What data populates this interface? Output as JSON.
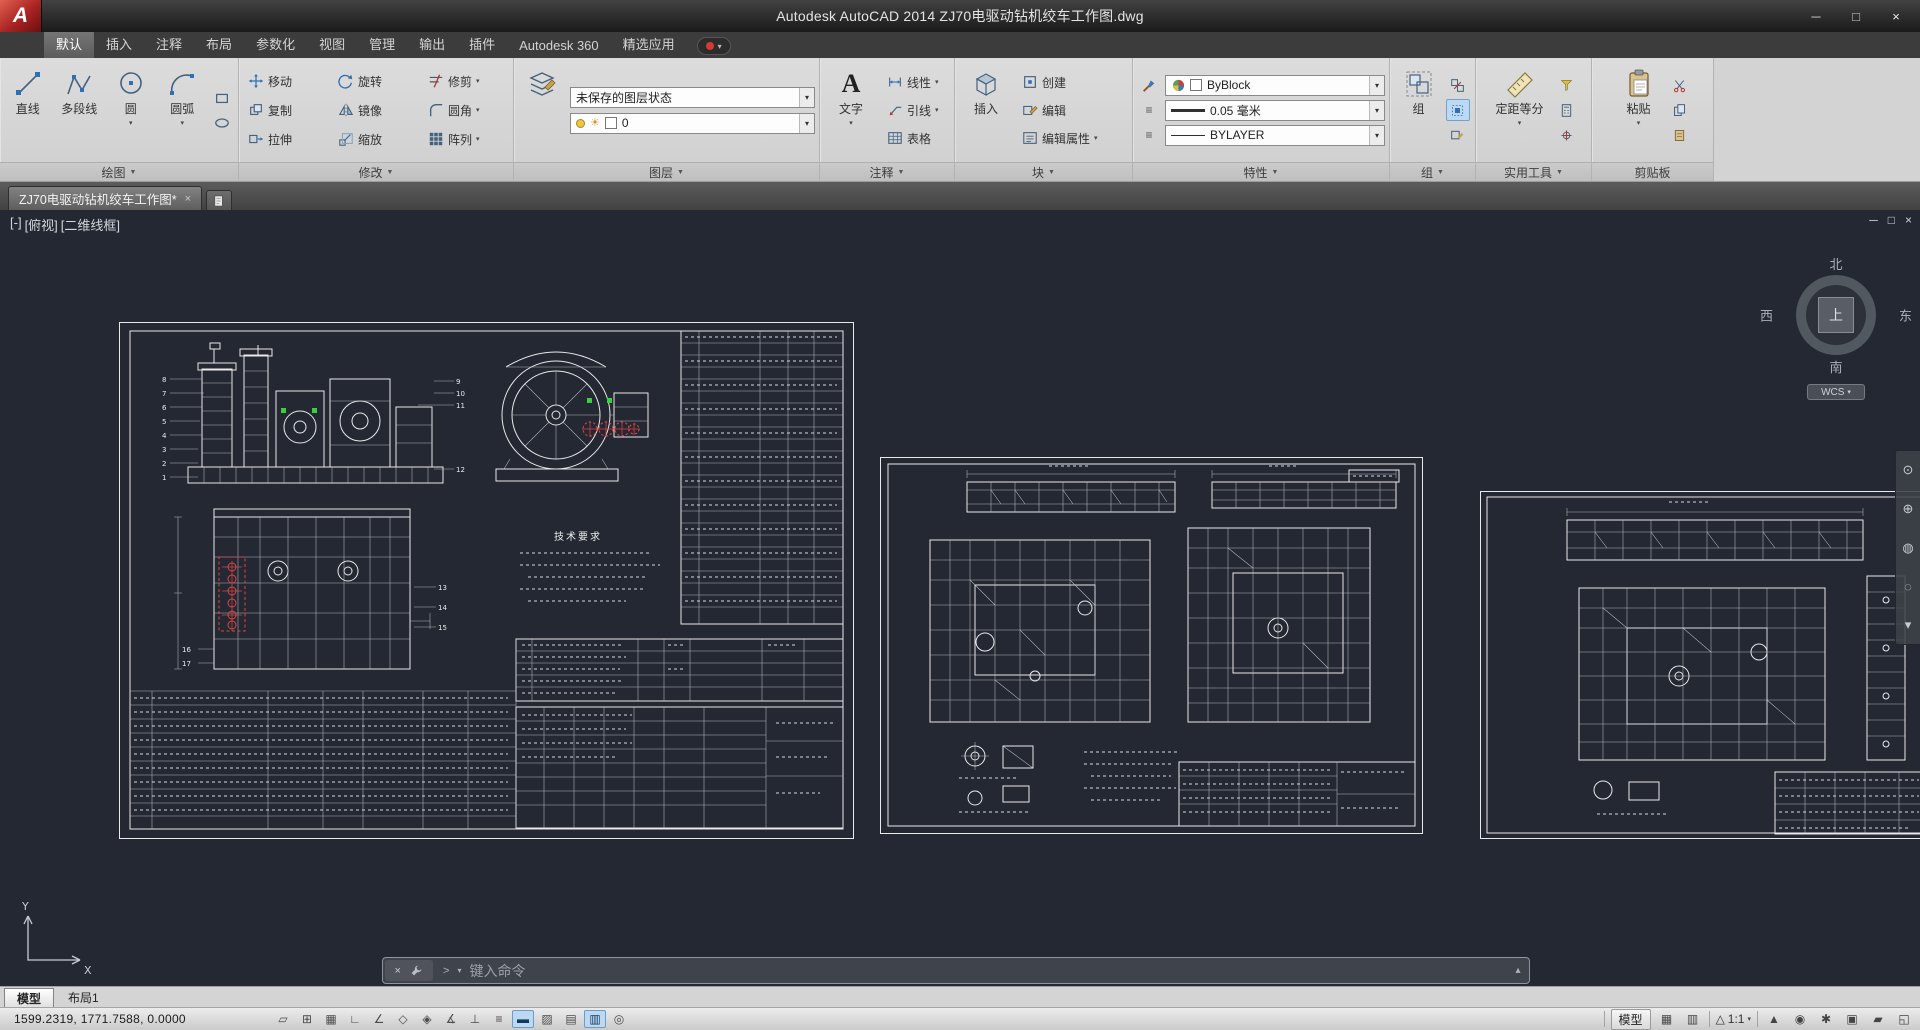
{
  "window": {
    "title": "Autodesk AutoCAD 2014   ZJ70电驱动钻机绞车工作图.dwg",
    "logo_letter": "A",
    "controls": {
      "minimize": "─",
      "maximize": "□",
      "close": "×"
    }
  },
  "icons": {
    "caret": "▼",
    "caret_small": "▾",
    "close": "×",
    "prompt": ">",
    "expand": "▴",
    "sun": "☀",
    "list": "≡",
    "vp_minimize": "─",
    "vp_restore": "□",
    "vp_close": "×",
    "nav": [
      {
        "name": "navigation-wheel",
        "glyph": "⊙"
      },
      {
        "name": "pan",
        "glyph": "⊕"
      },
      {
        "name": "zoom",
        "glyph": "◍"
      },
      {
        "name": "orbit",
        "glyph": "◌"
      },
      {
        "name": "show-more",
        "glyph": "▾"
      }
    ]
  },
  "menubar": {
    "tabs": [
      {
        "label": "默认",
        "active": true
      },
      {
        "label": "插入"
      },
      {
        "label": "注释"
      },
      {
        "label": "布局"
      },
      {
        "label": "参数化"
      },
      {
        "label": "视图"
      },
      {
        "label": "管理"
      },
      {
        "label": "输出"
      },
      {
        "label": "插件"
      },
      {
        "label": "Autodesk 360"
      },
      {
        "label": "精选应用"
      }
    ],
    "extra_caret": "▾"
  },
  "ribbon": {
    "draw": {
      "label": "绘图",
      "tools": [
        {
          "label": "直线",
          "icon": "line-icon"
        },
        {
          "label": "多段线",
          "icon": "polyline-icon"
        },
        {
          "label": "圆",
          "icon": "circle-icon"
        },
        {
          "label": "圆弧",
          "icon": "arc-icon"
        }
      ]
    },
    "modify": {
      "label": "修改",
      "tools": [
        {
          "label": "移动",
          "icon": "move-icon"
        },
        {
          "label": "旋转",
          "icon": "rotate-icon"
        },
        {
          "label": "修剪",
          "icon": "trim-icon"
        },
        {
          "label": "复制",
          "icon": "copy-icon"
        },
        {
          "label": "镜像",
          "icon": "mirror-icon"
        },
        {
          "label": "圆角",
          "icon": "fillet-icon"
        },
        {
          "label": "拉伸",
          "icon": "stretch-icon"
        },
        {
          "label": "缩放",
          "icon": "scale-icon"
        },
        {
          "label": "阵列",
          "icon": "array-icon"
        }
      ]
    },
    "layers": {
      "label": "图层",
      "layer_state": "未保存的图层状态",
      "current_layer": "0"
    },
    "annotation": {
      "label": "注释",
      "text_tool": "文字",
      "text_icon_letter": "A",
      "tools": [
        {
          "label": "线性",
          "icon": "linear-dimension-icon"
        },
        {
          "label": "引线",
          "icon": "leader-icon"
        },
        {
          "label": "表格",
          "icon": "table-icon"
        }
      ]
    },
    "block": {
      "label": "块",
      "insert_tool": "插入",
      "tools": [
        {
          "label": "创建",
          "icon": "create-block-icon"
        },
        {
          "label": "编辑",
          "icon": "edit-block-icon"
        },
        {
          "label": "编辑属性",
          "icon": "edit-attributes-icon"
        }
      ]
    },
    "properties": {
      "label": "特性",
      "color": "ByBlock",
      "lineweight": "0.05 毫米",
      "linetype": "BYLAYER"
    },
    "groups": {
      "label": "组",
      "group_tool": "组"
    },
    "utilities": {
      "label": "实用工具",
      "measure_tool": "定距等分"
    },
    "clipboard": {
      "label": "剪贴板",
      "paste_tool": "粘贴"
    }
  },
  "file_tabs": [
    {
      "label": "ZJ70电驱动钻机绞车工作图*",
      "active": true
    }
  ],
  "viewport": {
    "label": {
      "minus": "[-]",
      "view_name": "[俯视]",
      "visual_style": "[二维线框]"
    },
    "viewcube": {
      "north": "北",
      "south": "南",
      "east": "东",
      "west": "西",
      "top": "上",
      "wcs": "WCS"
    },
    "ucs": {
      "x": "X",
      "y": "Y"
    }
  },
  "drawing": {
    "notes_title": "技术要求",
    "balloons_left": [
      "8",
      "7",
      "6",
      "5",
      "4",
      "3",
      "2",
      "1"
    ],
    "balloons_right": [
      "9",
      "10",
      "11",
      "12"
    ],
    "balloons_side": [
      "13",
      "14",
      "15"
    ],
    "balloons_side2": [
      "16",
      "17"
    ]
  },
  "command_line": {
    "placeholder": "键入命令"
  },
  "layout_tabs": [
    {
      "label": "模型",
      "active": true
    },
    {
      "label": "布局1",
      "active": false
    }
  ],
  "status_bar": {
    "coordinates": "1599.2319, 1771.7588, 0.0000",
    "toggles": [
      {
        "name": "infer-constraints",
        "glyph": "▱",
        "active": false
      },
      {
        "name": "snap-mode",
        "glyph": "⊞",
        "active": false
      },
      {
        "name": "grid-display",
        "glyph": "▦",
        "active": false
      },
      {
        "name": "ortho-mode",
        "glyph": "∟",
        "active": false
      },
      {
        "name": "polar-tracking",
        "glyph": "∠",
        "active": false
      },
      {
        "name": "object-snap",
        "glyph": "◇",
        "active": false
      },
      {
        "name": "3d-object-snap",
        "glyph": "◈",
        "active": false
      },
      {
        "name": "object-snap-tracking",
        "glyph": "∡",
        "active": false
      },
      {
        "name": "dynamic-ucs",
        "glyph": "⊥",
        "active": false
      },
      {
        "name": "dynamic-input",
        "glyph": "≡",
        "active": false
      },
      {
        "name": "lineweight",
        "glyph": "▬",
        "active": true
      },
      {
        "name": "transparency",
        "glyph": "▨",
        "active": false
      },
      {
        "name": "quick-properties",
        "glyph": "▤",
        "active": false
      },
      {
        "name": "selection-cycling",
        "glyph": "▥",
        "active": true
      },
      {
        "name": "annotation-monitor",
        "glyph": "◎",
        "active": false
      }
    ],
    "model_button": "模型",
    "quickview": [
      {
        "name": "quick-view-layouts",
        "glyph": "▦"
      },
      {
        "name": "quick-view-drawings",
        "glyph": "▥"
      }
    ],
    "annotation_scale": {
      "icon": "△",
      "value": "1:1"
    },
    "tray": [
      {
        "name": "annotation-visibility",
        "glyph": "▲"
      },
      {
        "name": "auto-annotation-scale",
        "glyph": "◉"
      },
      {
        "name": "workspace-switching",
        "glyph": "✱"
      },
      {
        "name": "toolbar-lock",
        "glyph": "▣"
      },
      {
        "name": "performance",
        "glyph": "▰"
      },
      {
        "name": "clean-screen",
        "glyph": "◱"
      }
    ]
  }
}
